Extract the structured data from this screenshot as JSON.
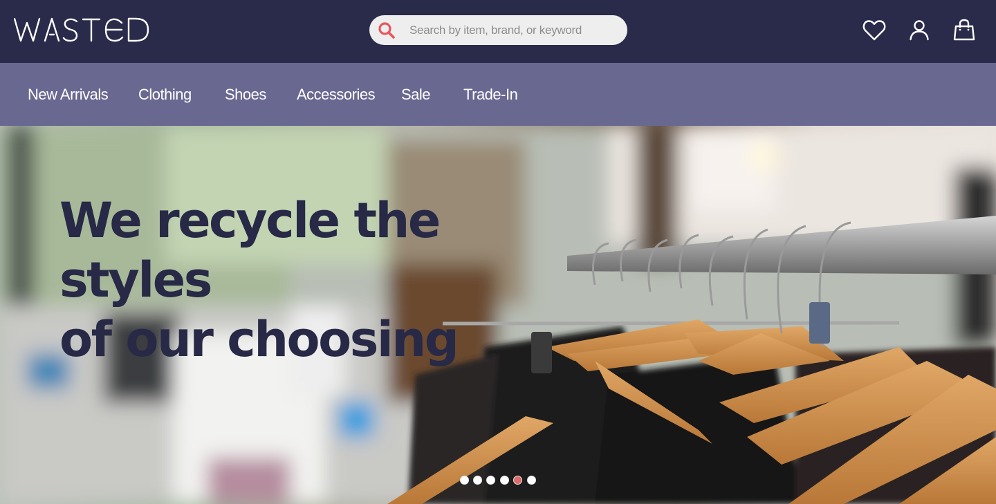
{
  "brand": {
    "logo_text": "WASTED"
  },
  "search": {
    "placeholder": "Search by item, brand, or keyword",
    "icon": "search-icon",
    "icon_color": "#e8565c"
  },
  "header_icons": [
    {
      "name": "heart-icon",
      "label": "Wishlist"
    },
    {
      "name": "user-icon",
      "label": "Account"
    },
    {
      "name": "bag-icon",
      "label": "Bag"
    }
  ],
  "nav": {
    "items": [
      {
        "label": "New Arrivals"
      },
      {
        "label": "Clothing"
      },
      {
        "label": "Shoes"
      },
      {
        "label": "Accessories"
      },
      {
        "label": "Sale"
      },
      {
        "label": "Trade-In"
      }
    ]
  },
  "hero": {
    "title_line1": "We recycle the styles",
    "title_line2": "of our choosing",
    "image_subject": "clothing rack with hangers",
    "slides_count": 6,
    "active_slide_number": 5
  },
  "colors": {
    "header_bg": "#2a2b4a",
    "nav_bg": "#696891",
    "hero_title": "#272946",
    "active_dot": "#d96c6c"
  }
}
